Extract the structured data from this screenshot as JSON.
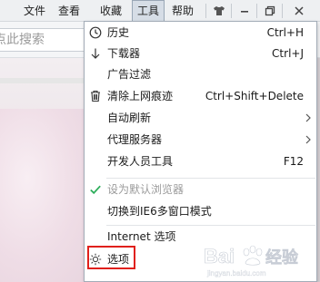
{
  "menubar": {
    "items": [
      "文件",
      "查看",
      "收藏",
      "工具",
      "帮助"
    ]
  },
  "search": {
    "placeholder": "点此搜索"
  },
  "tools_menu": {
    "items": [
      {
        "label": "历史",
        "shortcut": "Ctrl+H",
        "icon": "clock-icon"
      },
      {
        "label": "下载器",
        "shortcut": "Ctrl+J",
        "icon": "download-arrow-icon"
      },
      {
        "label": "广告过滤"
      },
      {
        "label": "清除上网痕迹",
        "shortcut": "Ctrl+Shift+Delete",
        "icon": "trash-icon"
      },
      {
        "label": "自动刷新",
        "submenu": true
      },
      {
        "label": "代理服务器",
        "submenu": true
      },
      {
        "label": "开发人员工具",
        "shortcut": "F12"
      },
      {
        "label": "设为默认浏览器",
        "disabled": true,
        "icon": "check-icon"
      },
      {
        "label": "切换到IE6多窗口模式"
      },
      {
        "label": "Internet 选项"
      },
      {
        "label": "选项",
        "icon": "gear-icon",
        "highlighted": true
      }
    ]
  },
  "colors": {
    "highlight": "#e0201c",
    "check": "#2eae5b",
    "menu_border": "#a3acb7"
  },
  "watermark": {
    "text": "Bai度经验"
  }
}
